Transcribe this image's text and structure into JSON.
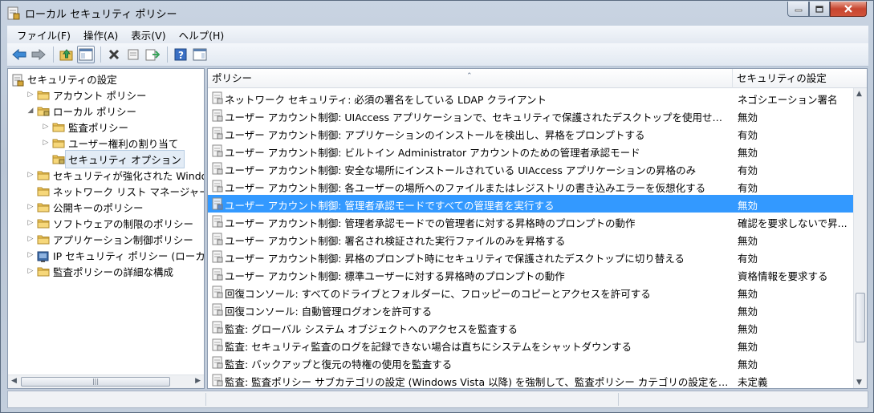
{
  "window": {
    "title": "ローカル セキュリティ ポリシー"
  },
  "menu": [
    "ファイル(F)",
    "操作(A)",
    "表示(V)",
    "ヘルプ(H)"
  ],
  "toolbar": {
    "icons": [
      "back-icon",
      "forward-icon",
      "up-folder-icon",
      "show-hide-tree-icon",
      "delete-icon",
      "properties-icon",
      "export-list-icon",
      "help-icon",
      "show-hide-action-pane-icon"
    ]
  },
  "tree": {
    "items": [
      {
        "label": "セキュリティの設定",
        "level": 0,
        "expander": "",
        "icon": "security-settings-icon"
      },
      {
        "label": "アカウント ポリシー",
        "level": 1,
        "expander": "▷",
        "icon": "folder-icon"
      },
      {
        "label": "ローカル ポリシー",
        "level": 1,
        "expander": "◢",
        "icon": "folder-icon"
      },
      {
        "label": "監査ポリシー",
        "level": 2,
        "expander": "▷",
        "icon": "folder-icon"
      },
      {
        "label": "ユーザー権利の割り当て",
        "level": 2,
        "expander": "▷",
        "icon": "folder-icon"
      },
      {
        "label": "セキュリティ オプション",
        "level": 2,
        "expander": "",
        "icon": "folder-icon",
        "selected": true
      },
      {
        "label": "セキュリティが強化された Windows",
        "level": 1,
        "expander": "▷",
        "icon": "folder-icon"
      },
      {
        "label": "ネットワーク リスト マネージャー ポ",
        "level": 1,
        "expander": "",
        "icon": "folder-icon"
      },
      {
        "label": "公開キーのポリシー",
        "level": 1,
        "expander": "▷",
        "icon": "folder-icon"
      },
      {
        "label": "ソフトウェアの制限のポリシー",
        "level": 1,
        "expander": "▷",
        "icon": "folder-icon"
      },
      {
        "label": "アプリケーション制御ポリシー",
        "level": 1,
        "expander": "▷",
        "icon": "folder-icon"
      },
      {
        "label": "IP セキュリティ ポリシー (ローカル",
        "level": 1,
        "expander": "▷",
        "icon": "ipsec-icon"
      },
      {
        "label": "監査ポリシーの詳細な構成",
        "level": 1,
        "expander": "▷",
        "icon": "folder-icon"
      }
    ]
  },
  "list": {
    "headers": {
      "policy": "ポリシー",
      "setting": "セキュリティの設定"
    },
    "rows": [
      {
        "policy": "ネットワーク セキュリティ: 必須の署名をしている LDAP クライアント",
        "setting": "ネゴシエーション署名"
      },
      {
        "policy": "ユーザー アカウント制御: UIAccess アプリケーションで、セキュリティで保護されたデスクトップを使用せずに...",
        "setting": "無効"
      },
      {
        "policy": "ユーザー アカウント制御: アプリケーションのインストールを検出し、昇格をプロンプトする",
        "setting": "有効"
      },
      {
        "policy": "ユーザー アカウント制御: ビルトイン Administrator アカウントのための管理者承認モード",
        "setting": "無効"
      },
      {
        "policy": "ユーザー アカウント制御: 安全な場所にインストールされている UIAccess アプリケーションの昇格のみ",
        "setting": "有効"
      },
      {
        "policy": "ユーザー アカウント制御: 各ユーザーの場所へのファイルまたはレジストリの書き込みエラーを仮想化する",
        "setting": "有効"
      },
      {
        "policy": "ユーザー アカウント制御: 管理者承認モードですべての管理者を実行する",
        "setting": "無効",
        "selected": true
      },
      {
        "policy": "ユーザー アカウント制御: 管理者承認モードでの管理者に対する昇格時のプロンプトの動作",
        "setting": "確認を要求しないで昇..."
      },
      {
        "policy": "ユーザー アカウント制御: 署名され検証された実行ファイルのみを昇格する",
        "setting": "無効"
      },
      {
        "policy": "ユーザー アカウント制御: 昇格のプロンプト時にセキュリティで保護されたデスクトップに切り替える",
        "setting": "有効"
      },
      {
        "policy": "ユーザー アカウント制御: 標準ユーザーに対する昇格時のプロンプトの動作",
        "setting": "資格情報を要求する"
      },
      {
        "policy": "回復コンソール: すべてのドライブとフォルダーに、フロッピーのコピーとアクセスを許可する",
        "setting": "無効"
      },
      {
        "policy": "回復コンソール: 自動管理ログオンを許可する",
        "setting": "無効"
      },
      {
        "policy": "監査: グローバル システム オブジェクトへのアクセスを監査する",
        "setting": "無効"
      },
      {
        "policy": "監査: セキュリティ監査のログを記録できない場合は直ちにシステムをシャットダウンする",
        "setting": "無効"
      },
      {
        "policy": "監査: バックアップと復元の特権の使用を監査する",
        "setting": "無効"
      },
      {
        "policy": "監査: 監査ポリシー サブカテゴリの設定 (Windows Vista 以降) を強制して、監査ポリシー カテゴリの設定を上書...",
        "setting": "未定義"
      }
    ]
  },
  "colors": {
    "selection": "#3399ff",
    "tree_selection": "#e3ecf6"
  }
}
